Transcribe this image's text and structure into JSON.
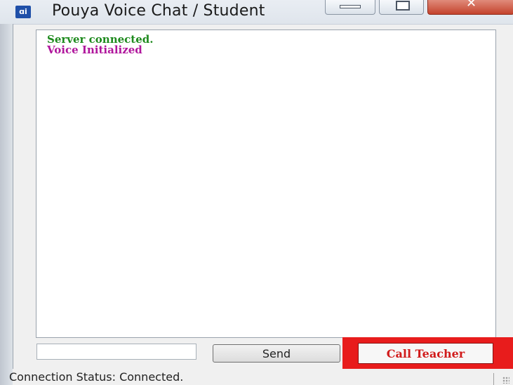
{
  "window": {
    "title": "Pouya Voice Chat / Student",
    "icon": "app-icon",
    "icon_glyph": "ɑi"
  },
  "chat": {
    "messages": [
      {
        "text": "Server connected.",
        "color": "#1e8a1e"
      },
      {
        "text": "Voice Initialized",
        "color": "#b0169c"
      }
    ]
  },
  "input": {
    "value": "",
    "placeholder": ""
  },
  "buttons": {
    "send_label": "Send",
    "call_label": "Call Teacher"
  },
  "status": {
    "text": "Connection Status: Connected."
  },
  "colors": {
    "highlight": "#e81c1c",
    "call_text": "#d11b1b"
  }
}
